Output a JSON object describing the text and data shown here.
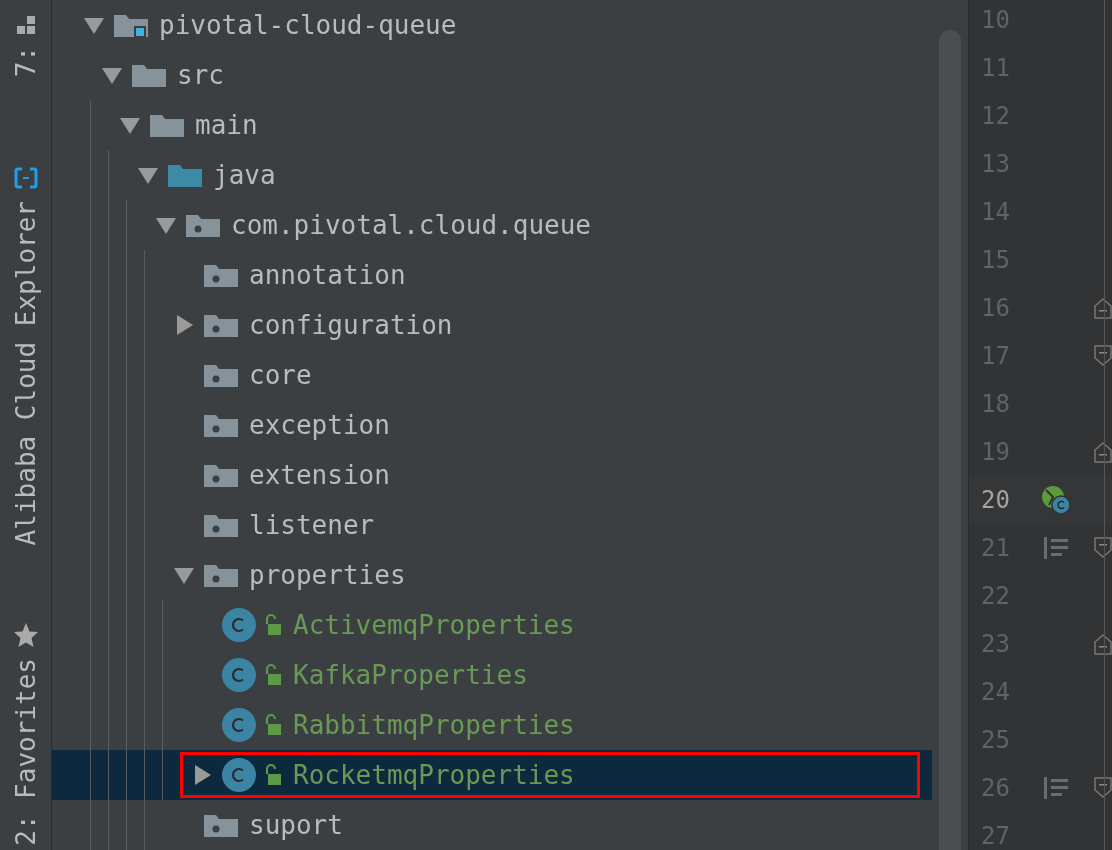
{
  "tool_strip": {
    "buttons": [
      {
        "label": "7:",
        "kind": "structure"
      },
      {
        "label": "Alibaba Cloud Explorer",
        "kind": "cloud"
      },
      {
        "label": "2: Favorites",
        "kind": "favorites"
      }
    ]
  },
  "tree": {
    "items": [
      {
        "label": "pivotal-cloud-queue",
        "kind": "module",
        "expanded": true,
        "selected": false,
        "children": [
          {
            "label": "src",
            "kind": "folder",
            "expanded": true,
            "selected": false,
            "children": [
              {
                "label": "main",
                "kind": "folder",
                "expanded": true,
                "selected": false,
                "children": [
                  {
                    "label": "java",
                    "kind": "source-folder",
                    "expanded": true,
                    "selected": false,
                    "children": [
                      {
                        "label": "com.pivotal.cloud.queue",
                        "kind": "package",
                        "expanded": true,
                        "selected": false,
                        "children": [
                          {
                            "label": "annotation",
                            "kind": "package",
                            "selected": false
                          },
                          {
                            "label": "configuration",
                            "kind": "package",
                            "expanded": false,
                            "selected": false
                          },
                          {
                            "label": "core",
                            "kind": "package",
                            "selected": false
                          },
                          {
                            "label": "exception",
                            "kind": "package",
                            "selected": false
                          },
                          {
                            "label": "extension",
                            "kind": "package",
                            "selected": false
                          },
                          {
                            "label": "listener",
                            "kind": "package",
                            "selected": false
                          },
                          {
                            "label": "properties",
                            "kind": "package",
                            "expanded": true,
                            "selected": false,
                            "children": [
                              {
                                "label": "ActivemqProperties",
                                "kind": "class",
                                "selected": false,
                                "highlighted": false
                              },
                              {
                                "label": "KafkaProperties",
                                "kind": "class",
                                "selected": false,
                                "highlighted": false
                              },
                              {
                                "label": "RabbitmqProperties",
                                "kind": "class",
                                "selected": false,
                                "highlighted": false
                              },
                              {
                                "label": "RocketmqProperties",
                                "kind": "class",
                                "expanded": false,
                                "selected": true,
                                "highlighted": true
                              }
                            ]
                          },
                          {
                            "label": "suport",
                            "kind": "package",
                            "selected": false
                          }
                        ]
                      }
                    ]
                  }
                ]
              }
            ]
          }
        ]
      }
    ]
  },
  "gutter": {
    "lines": [
      {
        "number": "10",
        "current": false,
        "kind": "plain",
        "fold_start": false,
        "fold_end": false
      },
      {
        "number": "11",
        "current": false,
        "kind": "plain",
        "fold_start": false,
        "fold_end": false
      },
      {
        "number": "12",
        "current": false,
        "kind": "plain",
        "fold_start": false,
        "fold_end": false
      },
      {
        "number": "13",
        "current": false,
        "kind": "plain",
        "fold_start": false,
        "fold_end": false
      },
      {
        "number": "14",
        "current": false,
        "kind": "plain",
        "fold_start": false,
        "fold_end": false
      },
      {
        "number": "15",
        "current": false,
        "kind": "plain",
        "fold_start": false,
        "fold_end": false
      },
      {
        "number": "16",
        "current": false,
        "kind": "plain",
        "fold_start": true,
        "fold_end": false
      },
      {
        "number": "17",
        "current": false,
        "kind": "plain",
        "fold_start": false,
        "fold_end": true
      },
      {
        "number": "18",
        "current": false,
        "kind": "plain",
        "fold_start": false,
        "fold_end": false
      },
      {
        "number": "19",
        "current": false,
        "kind": "plain",
        "fold_start": true,
        "fold_end": false
      },
      {
        "number": "20",
        "current": true,
        "kind": "bean",
        "fold_start": false,
        "fold_end": false
      },
      {
        "number": "21",
        "current": false,
        "kind": "method",
        "fold_start": false,
        "fold_end": true
      },
      {
        "number": "22",
        "current": false,
        "kind": "plain",
        "fold_start": false,
        "fold_end": false
      },
      {
        "number": "23",
        "current": false,
        "kind": "plain",
        "fold_start": true,
        "fold_end": false
      },
      {
        "number": "24",
        "current": false,
        "kind": "plain",
        "fold_start": false,
        "fold_end": false
      },
      {
        "number": "25",
        "current": false,
        "kind": "plain",
        "fold_start": false,
        "fold_end": false
      },
      {
        "number": "26",
        "current": false,
        "kind": "method",
        "fold_start": false,
        "fold_end": true
      },
      {
        "number": "27",
        "current": false,
        "kind": "plain",
        "fold_start": false,
        "fold_end": false
      }
    ]
  }
}
